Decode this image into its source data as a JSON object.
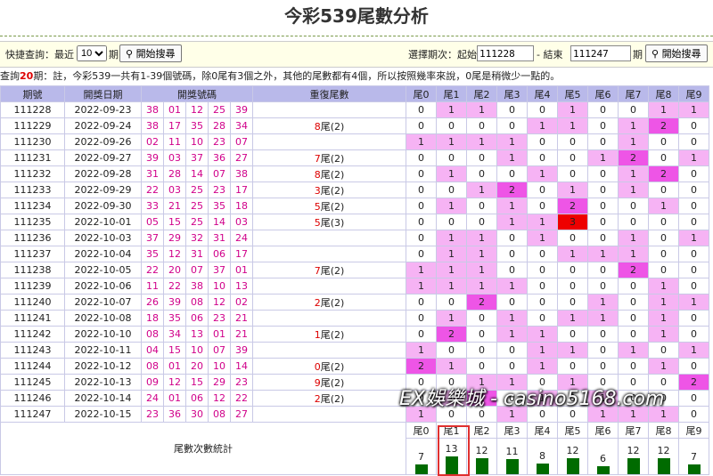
{
  "title": "今彩539尾數分析",
  "query": {
    "quick_label": "快捷查詢：最近",
    "recent_value": "10",
    "period_unit": "期",
    "search_button": "開始搜尋",
    "select_label": "選擇期次：起始",
    "start_value": "111228",
    "end_label": "- 結束",
    "end_value": "111247",
    "search_button2": "開始搜尋"
  },
  "note": {
    "prefix": "查詢",
    "count": "20",
    "suffix": "期：註，今彩539一共有1-39個號碼，除0尾有3個之外，其他的尾數都有4個，所以按照幾率來說，0尾是稍微少一點的。"
  },
  "headers": {
    "period": "期號",
    "date": "開獎日期",
    "numbers": "開獎號碼",
    "repeat": "重復尾數",
    "tails": [
      "尾0",
      "尾1",
      "尾2",
      "尾3",
      "尾4",
      "尾5",
      "尾6",
      "尾7",
      "尾8",
      "尾9"
    ]
  },
  "rows": [
    {
      "period": "111228",
      "date": "2022-09-23",
      "nums": [
        "38",
        "01",
        "12",
        "25",
        "39"
      ],
      "rep_n": "",
      "rep_t": "",
      "tails": [
        "0",
        "1",
        "1",
        "0",
        "0",
        "1",
        "0",
        "0",
        "1",
        "1"
      ]
    },
    {
      "period": "111229",
      "date": "2022-09-24",
      "nums": [
        "38",
        "17",
        "35",
        "28",
        "34"
      ],
      "rep_n": "8",
      "rep_t": "尾(2)",
      "tails": [
        "0",
        "0",
        "0",
        "0",
        "1",
        "1",
        "0",
        "1",
        "2",
        "0"
      ]
    },
    {
      "period": "111230",
      "date": "2022-09-26",
      "nums": [
        "02",
        "11",
        "10",
        "23",
        "07"
      ],
      "rep_n": "",
      "rep_t": "",
      "tails": [
        "1",
        "1",
        "1",
        "1",
        "0",
        "0",
        "0",
        "1",
        "0",
        "0"
      ]
    },
    {
      "period": "111231",
      "date": "2022-09-27",
      "nums": [
        "39",
        "03",
        "37",
        "36",
        "27"
      ],
      "rep_n": "7",
      "rep_t": "尾(2)",
      "tails": [
        "0",
        "0",
        "0",
        "1",
        "0",
        "0",
        "1",
        "2",
        "0",
        "1"
      ]
    },
    {
      "period": "111232",
      "date": "2022-09-28",
      "nums": [
        "31",
        "28",
        "14",
        "07",
        "38"
      ],
      "rep_n": "8",
      "rep_t": "尾(2)",
      "tails": [
        "0",
        "1",
        "0",
        "0",
        "1",
        "0",
        "0",
        "1",
        "2",
        "0"
      ]
    },
    {
      "period": "111233",
      "date": "2022-09-29",
      "nums": [
        "22",
        "03",
        "25",
        "23",
        "17"
      ],
      "rep_n": "3",
      "rep_t": "尾(2)",
      "tails": [
        "0",
        "0",
        "1",
        "2",
        "0",
        "1",
        "0",
        "1",
        "0",
        "0"
      ]
    },
    {
      "period": "111234",
      "date": "2022-09-30",
      "nums": [
        "33",
        "21",
        "25",
        "35",
        "18"
      ],
      "rep_n": "5",
      "rep_t": "尾(2)",
      "tails": [
        "0",
        "1",
        "0",
        "1",
        "0",
        "2",
        "0",
        "0",
        "1",
        "0"
      ]
    },
    {
      "period": "111235",
      "date": "2022-10-01",
      "nums": [
        "05",
        "15",
        "25",
        "14",
        "03"
      ],
      "rep_n": "5",
      "rep_t": "尾(3)",
      "tails": [
        "0",
        "0",
        "0",
        "1",
        "1",
        "3",
        "0",
        "0",
        "0",
        "0"
      ]
    },
    {
      "period": "111236",
      "date": "2022-10-03",
      "nums": [
        "37",
        "29",
        "32",
        "31",
        "24"
      ],
      "rep_n": "",
      "rep_t": "",
      "tails": [
        "0",
        "1",
        "1",
        "0",
        "1",
        "0",
        "0",
        "1",
        "0",
        "1"
      ]
    },
    {
      "period": "111237",
      "date": "2022-10-04",
      "nums": [
        "35",
        "12",
        "31",
        "06",
        "17"
      ],
      "rep_n": "",
      "rep_t": "",
      "tails": [
        "0",
        "1",
        "1",
        "0",
        "0",
        "1",
        "1",
        "1",
        "0",
        "0"
      ]
    },
    {
      "period": "111238",
      "date": "2022-10-05",
      "nums": [
        "22",
        "20",
        "07",
        "37",
        "01"
      ],
      "rep_n": "7",
      "rep_t": "尾(2)",
      "tails": [
        "1",
        "1",
        "1",
        "0",
        "0",
        "0",
        "0",
        "2",
        "0",
        "0"
      ]
    },
    {
      "period": "111239",
      "date": "2022-10-06",
      "nums": [
        "11",
        "22",
        "38",
        "10",
        "13"
      ],
      "rep_n": "",
      "rep_t": "",
      "tails": [
        "1",
        "1",
        "1",
        "1",
        "0",
        "0",
        "0",
        "0",
        "1",
        "0"
      ]
    },
    {
      "period": "111240",
      "date": "2022-10-07",
      "nums": [
        "26",
        "39",
        "08",
        "12",
        "02"
      ],
      "rep_n": "2",
      "rep_t": "尾(2)",
      "tails": [
        "0",
        "0",
        "2",
        "0",
        "0",
        "0",
        "1",
        "0",
        "1",
        "1"
      ]
    },
    {
      "period": "111241",
      "date": "2022-10-08",
      "nums": [
        "18",
        "35",
        "06",
        "23",
        "21"
      ],
      "rep_n": "",
      "rep_t": "",
      "tails": [
        "0",
        "1",
        "0",
        "1",
        "0",
        "1",
        "1",
        "0",
        "1",
        "0"
      ]
    },
    {
      "period": "111242",
      "date": "2022-10-10",
      "nums": [
        "08",
        "34",
        "13",
        "01",
        "21"
      ],
      "rep_n": "1",
      "rep_t": "尾(2)",
      "tails": [
        "0",
        "2",
        "0",
        "1",
        "1",
        "0",
        "0",
        "0",
        "1",
        "0"
      ]
    },
    {
      "period": "111243",
      "date": "2022-10-11",
      "nums": [
        "04",
        "15",
        "10",
        "07",
        "39"
      ],
      "rep_n": "",
      "rep_t": "",
      "tails": [
        "1",
        "0",
        "0",
        "0",
        "1",
        "1",
        "0",
        "1",
        "0",
        "1"
      ]
    },
    {
      "period": "111244",
      "date": "2022-10-12",
      "nums": [
        "08",
        "01",
        "20",
        "10",
        "14"
      ],
      "rep_n": "0",
      "rep_t": "尾(2)",
      "tails": [
        "2",
        "1",
        "0",
        "0",
        "1",
        "0",
        "0",
        "0",
        "1",
        "0"
      ]
    },
    {
      "period": "111245",
      "date": "2022-10-13",
      "nums": [
        "09",
        "12",
        "15",
        "29",
        "23"
      ],
      "rep_n": "9",
      "rep_t": "尾(2)",
      "tails": [
        "0",
        "0",
        "1",
        "1",
        "0",
        "1",
        "0",
        "0",
        "0",
        "2"
      ]
    },
    {
      "period": "111246",
      "date": "2022-10-14",
      "nums": [
        "24",
        "01",
        "06",
        "12",
        "22"
      ],
      "rep_n": "2",
      "rep_t": "尾(2)",
      "tails": [
        "0",
        "1",
        "2",
        "0",
        "1",
        "0",
        "1",
        "0",
        "0",
        "0"
      ]
    },
    {
      "period": "111247",
      "date": "2022-10-15",
      "nums": [
        "23",
        "36",
        "30",
        "08",
        "27"
      ],
      "rep_n": "",
      "rep_t": "",
      "tails": [
        "1",
        "0",
        "0",
        "1",
        "0",
        "0",
        "1",
        "1",
        "1",
        "0"
      ]
    }
  ],
  "stats": {
    "label": "尾數次數統計",
    "tails": [
      "尾0",
      "尾1",
      "尾2",
      "尾3",
      "尾4",
      "尾5",
      "尾6",
      "尾7",
      "尾8",
      "尾9"
    ],
    "counts": [
      "7",
      "13",
      "12",
      "11",
      "8",
      "12",
      "6",
      "12",
      "12",
      "7"
    ]
  },
  "colors": {
    "one": "#f6b3f4",
    "two": "#ee55e6",
    "three": "#e00000",
    "bar": "#006b00",
    "header": "#b9b9ea"
  },
  "watermark": "EX娛樂城 - casino5168.com"
}
